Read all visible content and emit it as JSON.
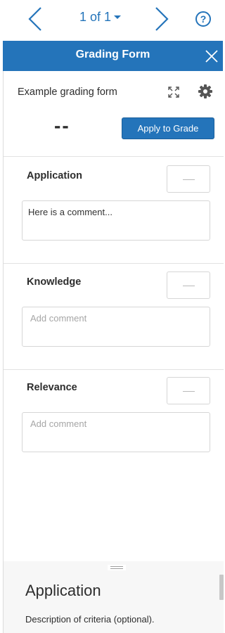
{
  "pager": {
    "label": "1 of 1",
    "prev_icon": "chevron-left-icon",
    "next_icon": "chevron-right-icon",
    "help_label": "?",
    "accent": "#2474ba"
  },
  "panel": {
    "title": "Grading Form",
    "close_icon": "close-icon",
    "header_color": "#2474ba"
  },
  "form": {
    "name": "Example grading form",
    "total_score": "--",
    "apply_label": "Apply to Grade"
  },
  "criteria": [
    {
      "name": "Application",
      "score": "",
      "comment_value": "Here is a comment...",
      "comment_placeholder": "Add comment"
    },
    {
      "name": "Knowledge",
      "score": "",
      "comment_value": "",
      "comment_placeholder": "Add comment"
    },
    {
      "name": "Relevance",
      "score": "",
      "comment_value": "",
      "comment_placeholder": "Add comment"
    }
  ],
  "description": {
    "title": "Application",
    "text": "Description of criteria (optional)."
  }
}
